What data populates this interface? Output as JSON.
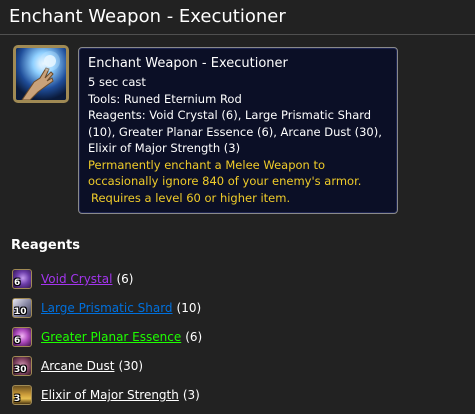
{
  "page": {
    "title": "Enchant Weapon - Executioner"
  },
  "spell": {
    "icon": "enchanting-hand-icon",
    "tooltip": {
      "name": "Enchant Weapon - Executioner",
      "cast_time": "5 sec cast",
      "tools": "Tools: Runed Eternium Rod",
      "reagents_text": "Reagents: Void Crystal (6), Large Prismatic Shard (10), Greater Planar Essence (6), Arcane Dust (30), Elixir of Major Strength (3)",
      "effect_line1": "Permanently enchant a Melee Weapon to",
      "effect_line2": "occasionally ignore 840 of your enemy's armor.",
      "requirement": "Requires a level 60 or higher item."
    }
  },
  "reagents_section": {
    "heading": "Reagents",
    "items": [
      {
        "name": "Void Crystal",
        "count": "(6)",
        "icon_qty": "6",
        "icon": "void-crystal-icon",
        "color": "#a335ee"
      },
      {
        "name": "Large Prismatic Shard",
        "count": "(10)",
        "icon_qty": "10",
        "icon": "prismatic-shard-icon",
        "color": "#0070dd"
      },
      {
        "name": "Greater Planar Essence",
        "count": "(6)",
        "icon_qty": "6",
        "icon": "planar-essence-icon",
        "color": "#1eff00"
      },
      {
        "name": "Arcane Dust",
        "count": "(30)",
        "icon_qty": "30",
        "icon": "arcane-dust-icon",
        "color": "#ffffff"
      },
      {
        "name": "Elixir of Major Strength",
        "count": "(3)",
        "icon_qty": "3",
        "icon": "elixir-icon",
        "color": "#ffffff"
      }
    ]
  },
  "colors": {
    "background": "#222222",
    "tooltip_bg": "#0b0f26",
    "effect_text": "#f0cc2a",
    "epic": "#a335ee",
    "rare": "#0070dd",
    "uncommon": "#1eff00",
    "common": "#ffffff"
  }
}
